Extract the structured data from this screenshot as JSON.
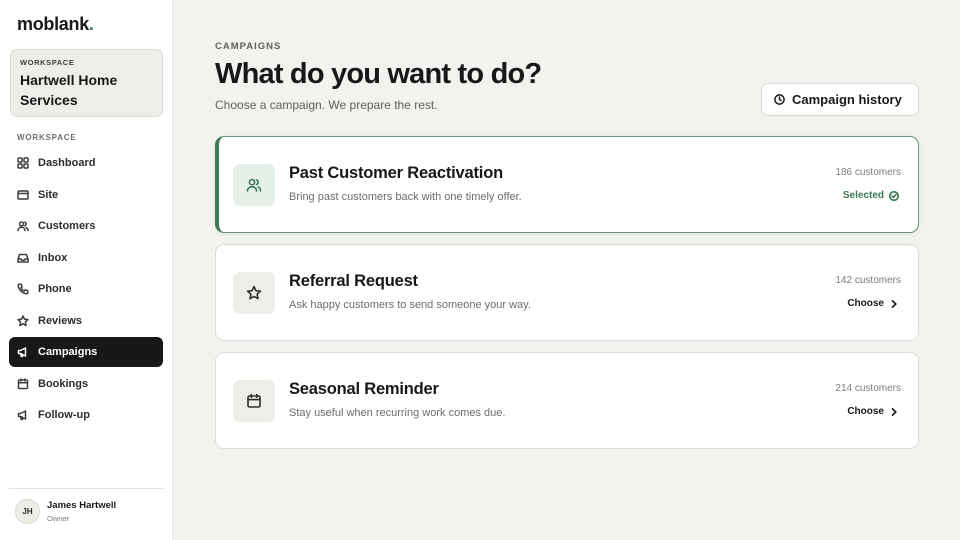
{
  "brand": {
    "name": "moblank",
    "dot": "."
  },
  "workspace_card": {
    "label": "WORKSPACE",
    "name": "Hartwell Home Services"
  },
  "sidebar": {
    "heading": "WORKSPACE",
    "items": [
      {
        "label": "Dashboard",
        "icon": "grid-icon"
      },
      {
        "label": "Site",
        "icon": "browser-icon"
      },
      {
        "label": "Customers",
        "icon": "users-icon"
      },
      {
        "label": "Inbox",
        "icon": "inbox-icon"
      },
      {
        "label": "Phone",
        "icon": "phone-icon"
      },
      {
        "label": "Reviews",
        "icon": "star-icon"
      },
      {
        "label": "Campaigns",
        "icon": "megaphone-icon",
        "active": true
      },
      {
        "label": "Bookings",
        "icon": "calendar-icon"
      },
      {
        "label": "Follow-up",
        "icon": "megaphone-icon"
      }
    ]
  },
  "user": {
    "initials": "JH",
    "name": "James Hartwell",
    "role": "Owner"
  },
  "page": {
    "eyebrow": "CAMPAIGNS",
    "title": "What do you want to do?",
    "subtitle": "Choose a campaign. We prepare the rest.",
    "history_button": "Campaign history"
  },
  "campaigns": [
    {
      "title": "Past Customer Reactivation",
      "desc": "Bring past customers back with one timely offer.",
      "count": "186 customers",
      "action": "Selected",
      "selected": true,
      "icon": "users-icon"
    },
    {
      "title": "Referral Request",
      "desc": "Ask happy customers to send someone your way.",
      "count": "142 customers",
      "action": "Choose",
      "selected": false,
      "icon": "star-icon"
    },
    {
      "title": "Seasonal Reminder",
      "desc": "Stay useful when recurring work comes due.",
      "count": "214 customers",
      "action": "Choose",
      "selected": false,
      "icon": "calendar-icon"
    }
  ],
  "colors": {
    "accent": "#3f7a55",
    "active_nav": "#16181a",
    "background": "#f3f2ee"
  }
}
